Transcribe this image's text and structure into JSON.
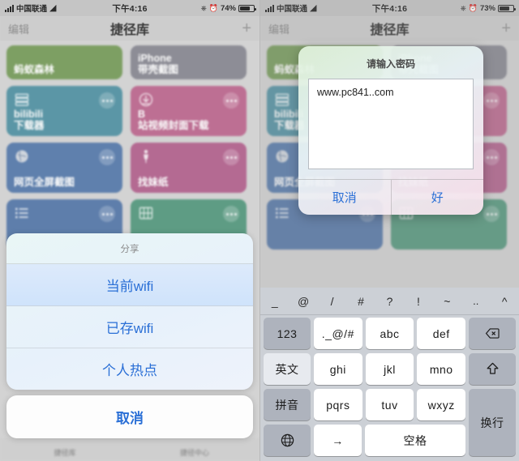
{
  "left": {
    "status": {
      "carrier": "中国联通",
      "time": "下午4:16",
      "battery": "74%",
      "wifi_icon": "wifi-icon",
      "rotation_icon": "rotation-lock-icon",
      "alarm_icon": "alarm-icon"
    },
    "nav": {
      "edit": "编辑",
      "title": "捷径库",
      "add": "+"
    },
    "tiles": [
      {
        "label": "蚂蚁森林",
        "color": "#7d9f63",
        "icon": "",
        "dots": false,
        "short": true
      },
      {
        "label": "iPhone\n带壳截图",
        "color": "#8d8d96",
        "icon": "",
        "dots": false,
        "short": true
      },
      {
        "label": "bilibili\n下载器",
        "color": "#5b96a6",
        "icon": "server-icon",
        "dots": true,
        "short": false
      },
      {
        "label": "B\n站视频封面下载",
        "color": "#bd6f93",
        "icon": "download-icon",
        "dots": true,
        "short": false
      },
      {
        "label": "网页全屏截图",
        "color": "#5f80ad",
        "icon": "globe-icon",
        "dots": true,
        "short": false
      },
      {
        "label": "找妹纸",
        "color": "#b46a92",
        "icon": "person-icon",
        "dots": true,
        "short": false
      },
      {
        "label": "",
        "color": "#5e7eab",
        "icon": "list-icon",
        "dots": true,
        "short": false
      },
      {
        "label": "",
        "color": "#5e9c84",
        "icon": "film-icon",
        "dots": true,
        "short": false
      }
    ],
    "share_sheet": {
      "title": "分享",
      "items": [
        "当前wifi",
        "已存wifi",
        "个人热点"
      ],
      "cancel": "取消"
    },
    "tabbar": [
      "捷径库",
      "捷径中心"
    ]
  },
  "right": {
    "status": {
      "carrier": "中国联通",
      "time": "下午4:16",
      "battery": "73%"
    },
    "nav": {
      "edit": "编辑",
      "title": "捷径库",
      "add": "+"
    },
    "dialog": {
      "title": "请输入密码",
      "value": "www.pc841..com",
      "cancel": "取消",
      "ok": "好"
    },
    "keyboard": {
      "suggestions": [
        "_",
        "@",
        "/",
        "#",
        "?",
        "!",
        "~",
        "..",
        "^"
      ],
      "rows": [
        [
          "123",
          "._@/#",
          "abc",
          "def",
          "backspace-icon"
        ],
        [
          "英文",
          "ghi",
          "jkl",
          "mno",
          "shift-icon"
        ],
        [
          "拼音",
          "pqrs",
          "tuv",
          "wxyz",
          "换行"
        ],
        [
          "globe-icon",
          "→",
          "空格"
        ]
      ],
      "labels": {
        "num": "123",
        "sym": "._@/#",
        "abc": "abc",
        "def": "def",
        "eng": "英文",
        "ghi": "ghi",
        "jkl": "jkl",
        "mno": "mno",
        "pinyin": "拼音",
        "pqrs": "pqrs",
        "tuv": "tuv",
        "wxyz": "wxyz",
        "return": "换行",
        "arrow": "→",
        "space": "空格"
      }
    }
  },
  "colors": {
    "accent_blue": "#2a6fd6",
    "sheet_bg": "#e7f1fb",
    "key_fn": "#aeb3bd"
  }
}
